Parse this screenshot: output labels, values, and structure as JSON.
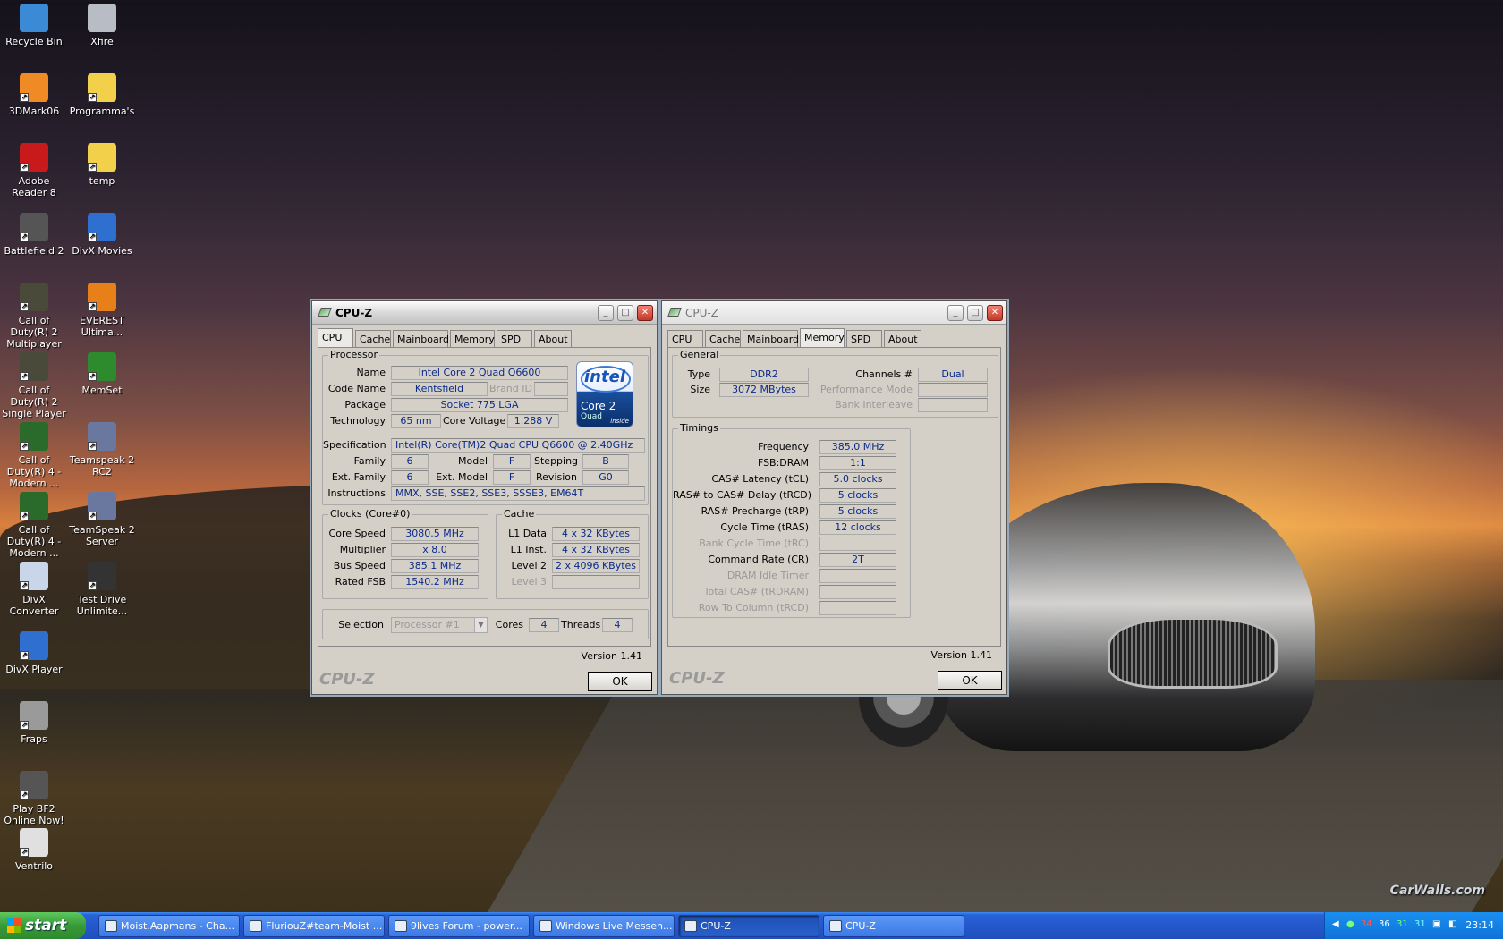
{
  "desktop": {
    "icons": [
      {
        "label": "Recycle Bin",
        "icon": "recycle-bin-icon",
        "color": "#3a8ad6"
      },
      {
        "label": "Xfire",
        "icon": "xfire-icon",
        "color": "#b8bcc4"
      },
      {
        "label": "3DMark06",
        "icon": "3dmark-icon",
        "color": "#f08a24"
      },
      {
        "label": "Programma's",
        "icon": "folder-icon",
        "color": "#f2d04a"
      },
      {
        "label": "Adobe Reader 8",
        "icon": "adobe-reader-icon",
        "color": "#c81a1a"
      },
      {
        "label": "temp",
        "icon": "folder-icon",
        "color": "#f2d04a"
      },
      {
        "label": "Battlefield 2",
        "icon": "battlefield-icon",
        "color": "#555"
      },
      {
        "label": "DivX Movies",
        "icon": "divx-icon",
        "color": "#2e6fcf"
      },
      {
        "label": "Call of Duty(R) 2 Multiplayer",
        "icon": "cod2-icon",
        "color": "#4a4a3a"
      },
      {
        "label": "EVEREST Ultima...",
        "icon": "everest-icon",
        "color": "#e8801a"
      },
      {
        "label": "Call of Duty(R) 2 Single Player",
        "icon": "cod2-icon",
        "color": "#4a4a3a"
      },
      {
        "label": "MemSet",
        "icon": "memset-icon",
        "color": "#2d8a2d"
      },
      {
        "label": "Call of Duty(R) 4 - Modern ...",
        "icon": "cod4-icon",
        "color": "#2a6a2a"
      },
      {
        "label": "Teamspeak 2 RC2",
        "icon": "teamspeak-icon",
        "color": "#6a78a0"
      },
      {
        "label": "Call of Duty(R) 4 - Modern ...",
        "icon": "cod4-icon",
        "color": "#2a6a2a"
      },
      {
        "label": "TeamSpeak 2 Server",
        "icon": "teamspeak-icon",
        "color": "#6a78a0"
      },
      {
        "label": "DivX Converter",
        "icon": "divx-converter-icon",
        "color": "#c9d6ea"
      },
      {
        "label": "Test Drive Unlimite...",
        "icon": "test-drive-icon",
        "color": "#333"
      },
      {
        "label": "DivX Player",
        "icon": "divx-player-icon",
        "color": "#2e6fcf"
      },
      {
        "label": "Fraps",
        "icon": "fraps-icon",
        "color": "#9a9a9a"
      },
      {
        "label": "Play BF2 Online Now!",
        "icon": "battlefield-icon",
        "color": "#555"
      },
      {
        "label": "Ventrilo",
        "icon": "ventrilo-icon",
        "color": "#e0e0e0"
      }
    ],
    "watermark": "CarWalls.com"
  },
  "cpuz1": {
    "title": "CPU-Z",
    "tabs": [
      "CPU",
      "Cache",
      "Mainboard",
      "Memory",
      "SPD",
      "About"
    ],
    "processor": {
      "group": "Processor",
      "name_l": "Name",
      "name": "Intel Core 2 Quad Q6600",
      "code_l": "Code Name",
      "code": "Kentsfield",
      "brand_l": "Brand ID",
      "brand": "",
      "package_l": "Package",
      "package": "Socket 775 LGA",
      "tech_l": "Technology",
      "tech": "65 nm",
      "volt_l": "Core Voltage",
      "volt": "1.288 V",
      "spec_l": "Specification",
      "spec": "Intel(R) Core(TM)2 Quad CPU    Q6600  @ 2.40GHz",
      "family_l": "Family",
      "family": "6",
      "model_l": "Model",
      "model": "F",
      "stepping_l": "Stepping",
      "stepping": "B",
      "extfam_l": "Ext. Family",
      "extfam": "6",
      "extmodel_l": "Ext. Model",
      "extmodel": "F",
      "revision_l": "Revision",
      "revision": "G0",
      "instr_l": "Instructions",
      "instr": "MMX, SSE, SSE2, SSE3, SSSE3, EM64T"
    },
    "intel_logo": {
      "brand": "intel",
      "product": "Core 2",
      "sub": "Quad",
      "inside": "inside"
    },
    "clocks": {
      "group": "Clocks (Core#0)",
      "core_l": "Core Speed",
      "core": "3080.5 MHz",
      "mult_l": "Multiplier",
      "mult": "x 8.0",
      "bus_l": "Bus Speed",
      "bus": "385.1 MHz",
      "fsb_l": "Rated FSB",
      "fsb": "1540.2 MHz"
    },
    "cache": {
      "group": "Cache",
      "l1d_l": "L1 Data",
      "l1d": "4 x 32 KBytes",
      "l1i_l": "L1 Inst.",
      "l1i": "4 x 32 KBytes",
      "l2_l": "Level 2",
      "l2": "2 x 4096 KBytes",
      "l3_l": "Level 3",
      "l3": ""
    },
    "selection": {
      "label": "Selection",
      "value": "Processor #1",
      "cores_l": "Cores",
      "cores": "4",
      "threads_l": "Threads",
      "threads": "4"
    },
    "version": "Version 1.41",
    "brand": "CPU-Z",
    "ok": "OK"
  },
  "cpuz2": {
    "title": "CPU-Z",
    "tabs": [
      "CPU",
      "Cache",
      "Mainboard",
      "Memory",
      "SPD",
      "About"
    ],
    "general": {
      "group": "General",
      "type_l": "Type",
      "type": "DDR2",
      "size_l": "Size",
      "size": "3072 MBytes",
      "channels_l": "Channels #",
      "channels": "Dual",
      "perf_l": "Performance Mode",
      "perf": "",
      "bank_l": "Bank Interleave",
      "bank": ""
    },
    "timings": {
      "group": "Timings",
      "rows": [
        {
          "label": "Frequency",
          "value": "385.0 MHz",
          "dim": false
        },
        {
          "label": "FSB:DRAM",
          "value": "1:1",
          "dim": false
        },
        {
          "label": "CAS# Latency (tCL)",
          "value": "5.0 clocks",
          "dim": false
        },
        {
          "label": "RAS# to CAS# Delay (tRCD)",
          "value": "5 clocks",
          "dim": false
        },
        {
          "label": "RAS# Precharge (tRP)",
          "value": "5 clocks",
          "dim": false
        },
        {
          "label": "Cycle Time (tRAS)",
          "value": "12 clocks",
          "dim": false
        },
        {
          "label": "Bank Cycle Time (tRC)",
          "value": "",
          "dim": true
        },
        {
          "label": "Command Rate (CR)",
          "value": "2T",
          "dim": false
        },
        {
          "label": "DRAM Idle Timer",
          "value": "",
          "dim": true
        },
        {
          "label": "Total CAS# (tRDRAM)",
          "value": "",
          "dim": true
        },
        {
          "label": "Row To Column (tRCD)",
          "value": "",
          "dim": true
        }
      ]
    },
    "version": "Version 1.41",
    "brand": "CPU-Z",
    "ok": "OK"
  },
  "taskbar": {
    "start": "start",
    "tasks": [
      {
        "label": "Moist.Aapmans - Cha...",
        "active": false
      },
      {
        "label": "FluriouZ#team-Moist ...",
        "active": false
      },
      {
        "label": "9lives Forum - power...",
        "active": false
      },
      {
        "label": "Windows Live Messen...",
        "active": false
      },
      {
        "label": "CPU-Z",
        "active": true
      },
      {
        "label": "CPU-Z",
        "active": false
      }
    ],
    "tray": {
      "t1": "34",
      "t2": "36",
      "t3": "31",
      "t4": "31",
      "clock": "23:14"
    }
  }
}
